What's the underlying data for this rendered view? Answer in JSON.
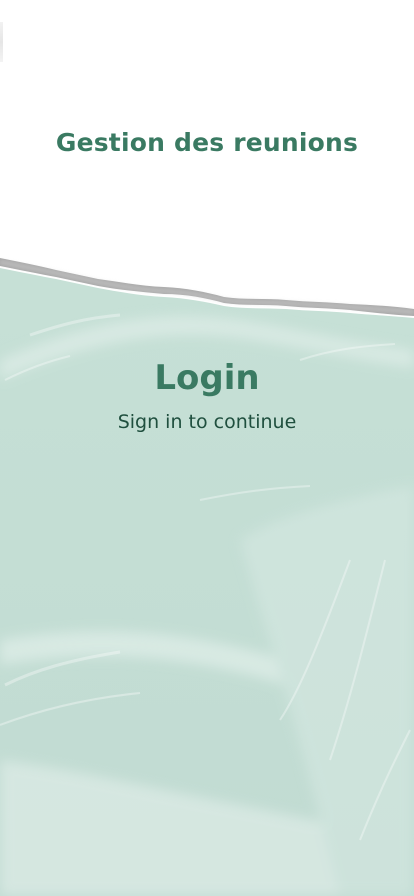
{
  "app": {
    "title": "Gestion des reunions"
  },
  "login": {
    "title": "Login",
    "subtitle": "Sign in to continue"
  },
  "colors": {
    "background_top": "#ffffff",
    "background_bottom": "#c1dcd3",
    "accent": "#3a7a62",
    "subtitle_text": "#1f4f3e",
    "torn_edge": "#9a9a9a"
  },
  "icons": {
    "background_decoration": "torn-paper-texture"
  }
}
